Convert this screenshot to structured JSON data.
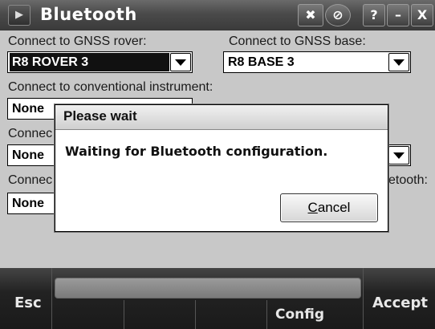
{
  "window": {
    "title": "Bluetooth",
    "buttons": {
      "help": "?",
      "minimize": "–",
      "close": "X"
    }
  },
  "form": {
    "rover_label": "Connect to GNSS rover:",
    "rover_value": "R8 ROVER 3",
    "base_label": "Connect to GNSS base:",
    "base_value": "R8 BASE 3",
    "conventional_label": "Connect to conventional instrument:",
    "conventional_value": "None",
    "row3_label": "Connec",
    "row3_value": "None",
    "row4_label": "Connec",
    "row4_value": "None",
    "row4_right_label": "etooth:"
  },
  "dialog": {
    "title": "Please wait",
    "message": "Waiting for Bluetooth configuration.",
    "cancel_label": "Cancel"
  },
  "bottom": {
    "esc_label": "Esc",
    "config_label": "Config",
    "accept_label": "Accept"
  }
}
